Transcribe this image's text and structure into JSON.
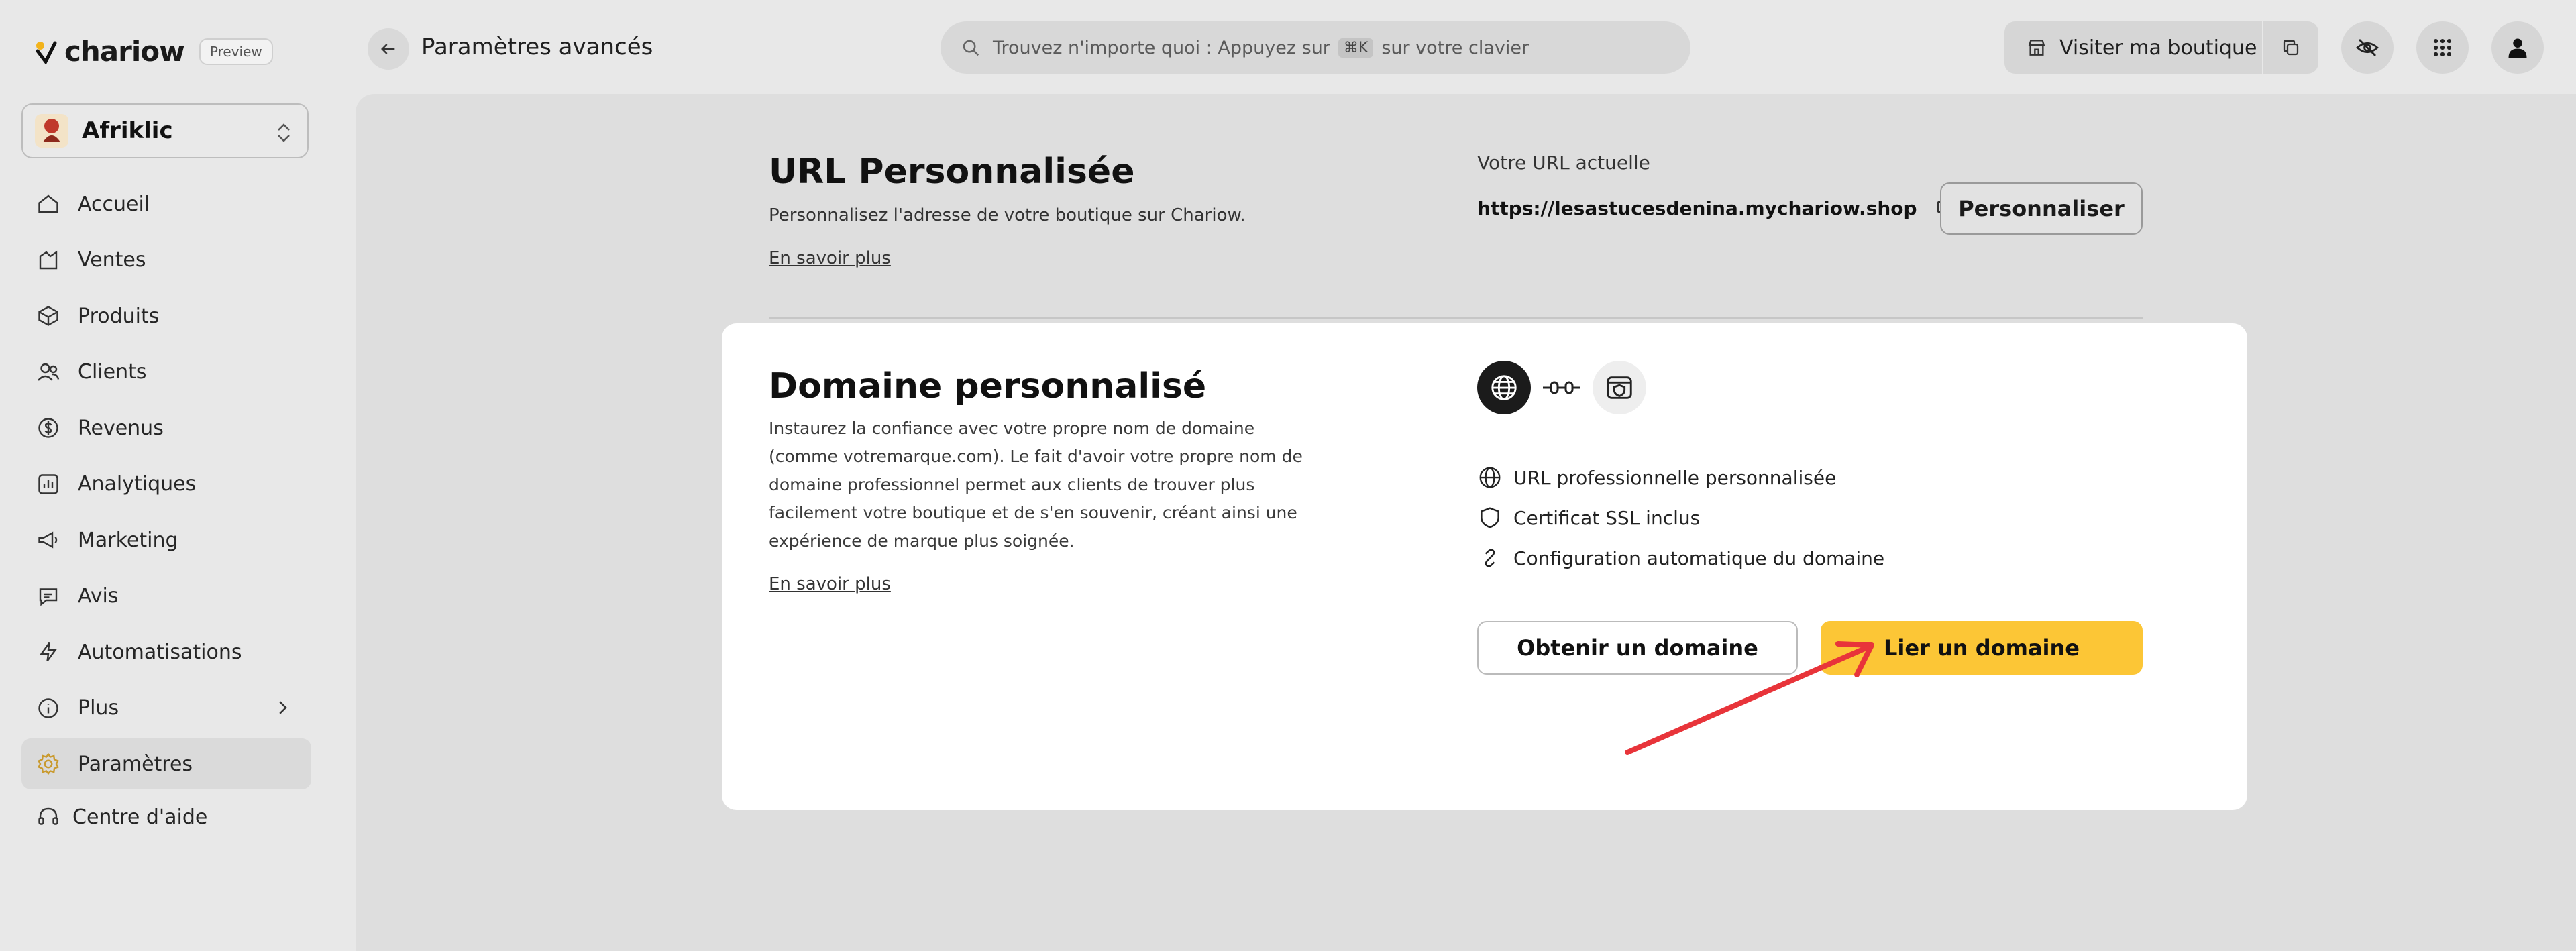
{
  "brand": {
    "name": "chariow",
    "badge": "Preview"
  },
  "store": {
    "name": "Afriklic"
  },
  "sidebar": {
    "items": [
      {
        "label": "Accueil",
        "icon": "home-icon"
      },
      {
        "label": "Ventes",
        "icon": "sales-icon"
      },
      {
        "label": "Produits",
        "icon": "box-icon"
      },
      {
        "label": "Clients",
        "icon": "users-icon"
      },
      {
        "label": "Revenus",
        "icon": "dollar-icon"
      },
      {
        "label": "Analytiques",
        "icon": "chart-icon"
      },
      {
        "label": "Marketing",
        "icon": "megaphone-icon"
      },
      {
        "label": "Avis",
        "icon": "chat-icon"
      },
      {
        "label": "Automatisations",
        "icon": "bolt-icon"
      },
      {
        "label": "Plus",
        "icon": "info-icon"
      },
      {
        "label": "Paramètres",
        "icon": "gear-icon",
        "active": true
      }
    ],
    "help": "Centre d'aide"
  },
  "header": {
    "title": "Paramètres avancés",
    "search_prefix": "Trouvez n'importe quoi : Appuyez sur",
    "search_shortcut": "⌘K",
    "search_suffix": "sur votre clavier",
    "visit_store": "Visiter ma boutique"
  },
  "url_section": {
    "title": "URL Personnalisée",
    "description": "Personnalisez l'adresse de votre boutique sur Chariow.",
    "learn_more": "En savoir plus",
    "current_label": "Votre URL actuelle",
    "current_url": "https://lesastucesdenina.mychariow.shop",
    "customize_button": "Personnaliser"
  },
  "domain_card": {
    "title": "Domaine personnalisé",
    "description": "Instaurez la confiance avec votre propre nom de domaine (comme votremarque.com). Le fait d'avoir votre propre nom de domaine professionnel permet aux clients de trouver plus facilement votre boutique et de s'en souvenir, créant ainsi une expérience de marque plus soignée.",
    "learn_more": "En savoir plus",
    "features": [
      {
        "label": "URL professionnelle personnalisée",
        "icon": "globe-icon"
      },
      {
        "label": "Certificat SSL inclus",
        "icon": "shield-icon"
      },
      {
        "label": "Configuration automatique du domaine",
        "icon": "link-icon"
      }
    ],
    "get_domain_button": "Obtenir un domaine",
    "link_domain_button": "Lier un domaine"
  },
  "colors": {
    "accent": "#fcc636",
    "annotation_arrow": "#e8343a"
  }
}
